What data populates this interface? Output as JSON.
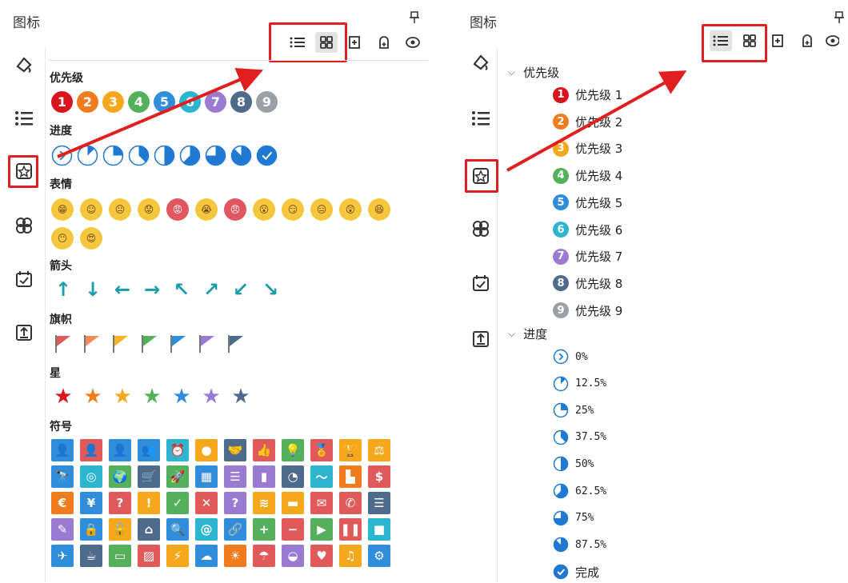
{
  "panel_title": "图标",
  "pin_glyph": "ᵖ",
  "sections": {
    "priority": "优先级",
    "progress": "进度",
    "emotion": "表情",
    "arrows": "箭头",
    "flags": "旗帜",
    "stars": "星",
    "symbols": "符号"
  },
  "priority_colors": [
    "#d9141c",
    "#f07c1e",
    "#f5a81c",
    "#55b05c",
    "#2f8ddc",
    "#2db5d0",
    "#9b7ad2",
    "#4f6b8c",
    "#9aa0a6"
  ],
  "priority_numbers": [
    "1",
    "2",
    "3",
    "4",
    "5",
    "6",
    "7",
    "8",
    "9"
  ],
  "progress_fill": [
    0,
    12.5,
    25,
    37.5,
    50,
    62.5,
    75,
    87.5,
    100
  ],
  "emotion_glyphs": [
    "😁",
    "☺",
    "😐",
    "😟",
    "😡",
    "😭",
    "😠",
    "😮",
    "😏",
    "😑",
    "😲",
    "😆",
    "😶",
    "😍"
  ],
  "arrow_glyphs": [
    "↑",
    "↓",
    "←",
    "→",
    "↖",
    "↗",
    "↙",
    "↘"
  ],
  "flag_colors": [
    "#e05a5a",
    "#f28a5a",
    "#f5b32b",
    "#55b05c",
    "#2f8ddc",
    "#9b7ad2",
    "#4f6b8c"
  ],
  "star_colors": [
    "#d9141c",
    "#f07c1e",
    "#f5a81c",
    "#55b05c",
    "#2f8ddc",
    "#9b7ad2",
    "#4f6b8c"
  ],
  "symbols": {
    "rows": [
      [
        {
          "c": "#2f8ddc",
          "g": "👤"
        },
        {
          "c": "#e05a5a",
          "g": "👤"
        },
        {
          "c": "#2f8ddc",
          "g": "👤"
        },
        {
          "c": "#2f8ddc",
          "g": "👥"
        },
        {
          "c": "#2db5d0",
          "g": "⏰"
        },
        {
          "c": "#f5a81c",
          "g": "●"
        },
        {
          "c": "#4f6b8c",
          "g": "🤝"
        },
        {
          "c": "#e05a5a",
          "g": "👍"
        },
        {
          "c": "#55b05c",
          "g": "💡"
        },
        {
          "c": "#e05a5a",
          "g": "🏅"
        },
        {
          "c": "#f5a81c",
          "g": "🏆"
        },
        {
          "c": "#f5a81c",
          "g": "⚖"
        }
      ],
      [
        {
          "c": "#2f8ddc",
          "g": "🔭"
        },
        {
          "c": "#2db5d0",
          "g": "◎"
        },
        {
          "c": "#55b05c",
          "g": "🌍"
        },
        {
          "c": "#4f6b8c",
          "g": "🛒"
        },
        {
          "c": "#55b05c",
          "g": "🚀"
        },
        {
          "c": "#2f8ddc",
          "g": "▦"
        },
        {
          "c": "#9b7ad2",
          "g": "☰"
        },
        {
          "c": "#9b7ad2",
          "g": "▮"
        },
        {
          "c": "#4f6b8c",
          "g": "◔"
        },
        {
          "c": "#2db5d0",
          "g": "〜"
        },
        {
          "c": "#f07c1e",
          "g": "▙"
        },
        {
          "c": "#e05a5a",
          "g": "$"
        }
      ],
      [
        {
          "c": "#f07c1e",
          "g": "€"
        },
        {
          "c": "#2f8ddc",
          "g": "¥"
        },
        {
          "c": "#e05a5a",
          "g": "?"
        },
        {
          "c": "#f5a81c",
          "g": "!"
        },
        {
          "c": "#55b05c",
          "g": "✓"
        },
        {
          "c": "#e05a5a",
          "g": "✕"
        },
        {
          "c": "#9b7ad2",
          "g": "?"
        },
        {
          "c": "#f5a81c",
          "g": "≋"
        },
        {
          "c": "#f5a81c",
          "g": "▬"
        },
        {
          "c": "#e05a5a",
          "g": "✉"
        },
        {
          "c": "#e05a5a",
          "g": "✆"
        },
        {
          "c": "#4f6b8c",
          "g": "☰"
        }
      ],
      [
        {
          "c": "#9b7ad2",
          "g": "✎"
        },
        {
          "c": "#2f8ddc",
          "g": "🔒"
        },
        {
          "c": "#f5a81c",
          "g": "🔓"
        },
        {
          "c": "#4f6b8c",
          "g": "⌂"
        },
        {
          "c": "#2f8ddc",
          "g": "🔍"
        },
        {
          "c": "#2db5d0",
          "g": "@"
        },
        {
          "c": "#2f8ddc",
          "g": "🔗"
        },
        {
          "c": "#55b05c",
          "g": "+"
        },
        {
          "c": "#e05a5a",
          "g": "−"
        },
        {
          "c": "#55b05c",
          "g": "▶"
        },
        {
          "c": "#e05a5a",
          "g": "❚❚"
        },
        {
          "c": "#2db5d0",
          "g": "■"
        }
      ],
      [
        {
          "c": "#2f8ddc",
          "g": "✈"
        },
        {
          "c": "#4f6b8c",
          "g": "☕"
        },
        {
          "c": "#55b05c",
          "g": "▭"
        },
        {
          "c": "#e05a5a",
          "g": "▨"
        },
        {
          "c": "#f5a81c",
          "g": "⚡"
        },
        {
          "c": "#2f8ddc",
          "g": "☁"
        },
        {
          "c": "#f07c1e",
          "g": "☀"
        },
        {
          "c": "#e05a5a",
          "g": "☂"
        },
        {
          "c": "#9b7ad2",
          "g": "◒"
        },
        {
          "c": "#e05a5a",
          "g": "♥"
        },
        {
          "c": "#f5a81c",
          "g": "♫"
        },
        {
          "c": "#2f8ddc",
          "g": "⚙"
        }
      ]
    ]
  },
  "tree": {
    "priority_label": "优先级",
    "priority_items": [
      "优先级 1",
      "优先级 2",
      "优先级 3",
      "优先级 4",
      "优先级 5",
      "优先级 6",
      "优先级 7",
      "优先级 8",
      "优先级 9"
    ],
    "progress_label": "进度",
    "progress_items": [
      "0%",
      "12.5%",
      "25%",
      "37.5%",
      "50%",
      "62.5%",
      "75%",
      "87.5%",
      "完成"
    ]
  }
}
